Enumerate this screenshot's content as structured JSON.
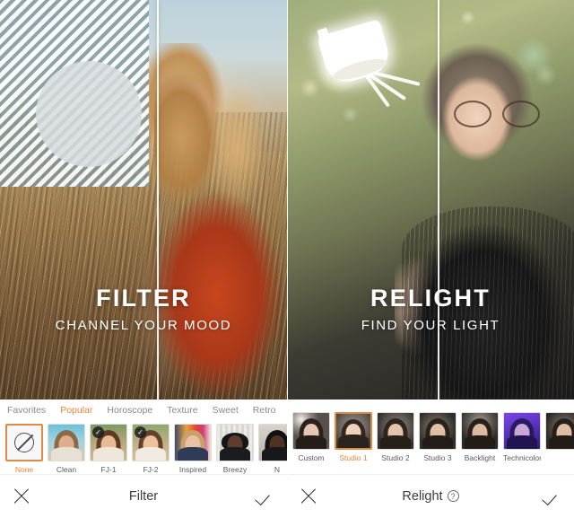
{
  "app": {
    "panels": [
      {
        "id": "filter-panel",
        "hero": {
          "title": "FILTER",
          "subtitle": "CHANNEL YOUR MOOD"
        },
        "categories": [
          {
            "label": "Favorites",
            "active": false
          },
          {
            "label": "Popular",
            "active": true
          },
          {
            "label": "Horoscope",
            "active": false
          },
          {
            "label": "Texture",
            "active": false
          },
          {
            "label": "Sweet",
            "active": false
          },
          {
            "label": "Retro",
            "active": false
          }
        ],
        "presets": [
          {
            "label": "None",
            "selected": true,
            "badge": "",
            "kind": "none-icon"
          },
          {
            "label": "Clean",
            "selected": false,
            "badge": "",
            "kind": "portrait-beach"
          },
          {
            "label": "FJ-1",
            "selected": false,
            "badge": "✓",
            "kind": "portrait-warm"
          },
          {
            "label": "FJ-2",
            "selected": false,
            "badge": "✓",
            "kind": "portrait-warm2"
          },
          {
            "label": "Inspired",
            "selected": false,
            "badge": "",
            "kind": "portrait-colorful"
          },
          {
            "label": "Breezy",
            "selected": false,
            "badge": "",
            "kind": "portrait-hat"
          },
          {
            "label": "N",
            "selected": false,
            "badge": "",
            "kind": "portrait-dark"
          }
        ],
        "bottom_bar": {
          "close_icon": "close-icon",
          "title": "Filter",
          "help": "",
          "confirm_icon": "checkmark-icon"
        }
      },
      {
        "id": "relight-panel",
        "hero": {
          "title": "RELIGHT",
          "subtitle": "FIND YOUR LIGHT"
        },
        "presets": [
          {
            "label": "Custom",
            "selected": false,
            "kind": "light-custom"
          },
          {
            "label": "Studio 1",
            "selected": true,
            "kind": "light-studio1"
          },
          {
            "label": "Studio 2",
            "selected": false,
            "kind": "light-studio2"
          },
          {
            "label": "Studio 3",
            "selected": false,
            "kind": "light-studio3"
          },
          {
            "label": "Backlight",
            "selected": false,
            "kind": "light-backlight"
          },
          {
            "label": "Technicolor",
            "selected": false,
            "kind": "light-technicolor"
          },
          {
            "label": "",
            "selected": false,
            "kind": "light-extra"
          }
        ],
        "bottom_bar": {
          "close_icon": "close-icon",
          "title": "Relight",
          "help": "?",
          "confirm_icon": "checkmark-icon"
        }
      }
    ],
    "colors": {
      "accent": "#e8853a",
      "selection_border": "#e08b45",
      "text_primary": "#3c3c3c",
      "text_muted": "#8a8a8a",
      "surface": "#ffffff"
    }
  }
}
